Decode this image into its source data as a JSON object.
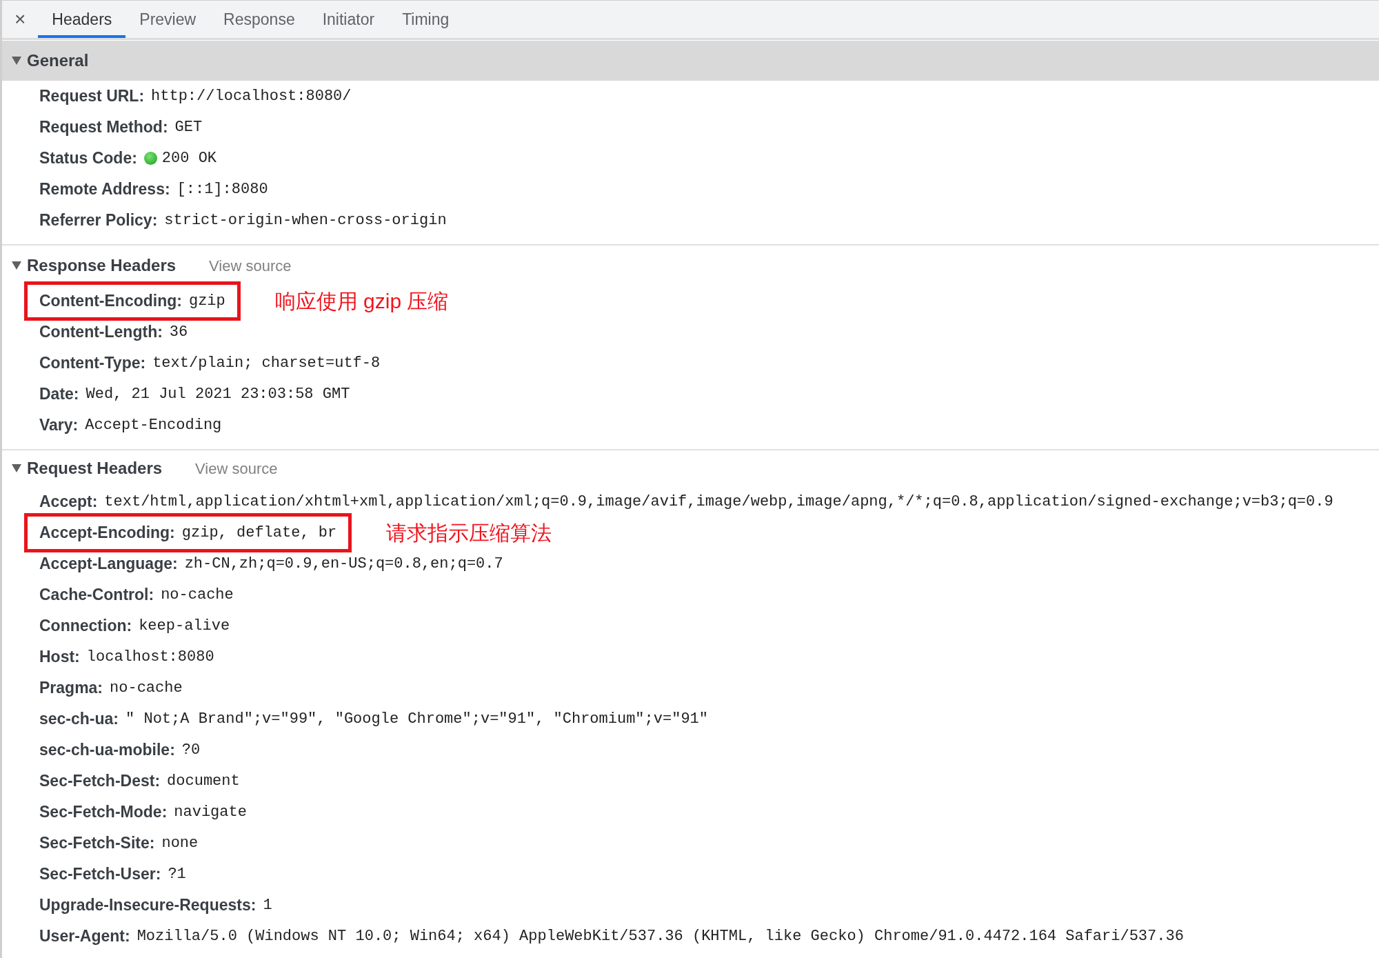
{
  "close_button": "×",
  "tabs": [
    {
      "label": "Headers",
      "selected": true
    },
    {
      "label": "Preview",
      "selected": false
    },
    {
      "label": "Response",
      "selected": false
    },
    {
      "label": "Initiator",
      "selected": false
    },
    {
      "label": "Timing",
      "selected": false
    }
  ],
  "sections": [
    {
      "title": "General",
      "expanded": true,
      "selected": true,
      "rows": [
        {
          "kind": "plain",
          "name": "Request URL:",
          "value": "http://localhost:8080/",
          "highlighted": false
        },
        {
          "kind": "plain",
          "name": "Request Method:",
          "value": "GET",
          "highlighted": false
        },
        {
          "kind": "status",
          "name": "Status Code:",
          "value": "200 OK",
          "highlighted": false
        },
        {
          "kind": "plain",
          "name": "Remote Address:",
          "value": "[::1]:8080",
          "highlighted": false
        },
        {
          "kind": "plain",
          "name": "Referrer Policy:",
          "value": "strict-origin-when-cross-origin",
          "highlighted": false
        }
      ]
    },
    {
      "title": "Response Headers",
      "link": "View source",
      "expanded": true,
      "selected": false,
      "rows": [
        {
          "kind": "plain",
          "name": "Content-Encoding:",
          "value": "gzip",
          "highlighted": true,
          "annotation": "响应使用 gzip 压缩"
        },
        {
          "kind": "plain",
          "name": "Content-Length:",
          "value": "36",
          "highlighted": false
        },
        {
          "kind": "plain",
          "name": "Content-Type:",
          "value": "text/plain; charset=utf-8",
          "highlighted": false
        },
        {
          "kind": "plain",
          "name": "Date:",
          "value": "Wed, 21 Jul 2021 23:03:58 GMT",
          "highlighted": false
        },
        {
          "kind": "plain",
          "name": "Vary:",
          "value": "Accept-Encoding",
          "highlighted": false
        }
      ]
    },
    {
      "title": "Request Headers",
      "link": "View source",
      "expanded": true,
      "selected": false,
      "rows": [
        {
          "kind": "plain",
          "name": "Accept:",
          "value": "text/html,application/xhtml+xml,application/xml;q=0.9,image/avif,image/webp,image/apng,*/*;q=0.8,application/signed-exchange;v=b3;q=0.9",
          "highlighted": false
        },
        {
          "kind": "plain",
          "name": "Accept-Encoding:",
          "value": "gzip, deflate, br",
          "highlighted": true,
          "annotation": "请求指示压缩算法"
        },
        {
          "kind": "plain",
          "name": "Accept-Language:",
          "value": "zh-CN,zh;q=0.9,en-US;q=0.8,en;q=0.7",
          "highlighted": false
        },
        {
          "kind": "plain",
          "name": "Cache-Control:",
          "value": "no-cache",
          "highlighted": false
        },
        {
          "kind": "plain",
          "name": "Connection:",
          "value": "keep-alive",
          "highlighted": false
        },
        {
          "kind": "plain",
          "name": "Host:",
          "value": "localhost:8080",
          "highlighted": false
        },
        {
          "kind": "plain",
          "name": "Pragma:",
          "value": "no-cache",
          "highlighted": false
        },
        {
          "kind": "plain",
          "name": "sec-ch-ua:",
          "value": "\" Not;A Brand\";v=\"99\", \"Google Chrome\";v=\"91\", \"Chromium\";v=\"91\"",
          "highlighted": false
        },
        {
          "kind": "plain",
          "name": "sec-ch-ua-mobile:",
          "value": "?0",
          "highlighted": false
        },
        {
          "kind": "plain",
          "name": "Sec-Fetch-Dest:",
          "value": "document",
          "highlighted": false
        },
        {
          "kind": "plain",
          "name": "Sec-Fetch-Mode:",
          "value": "navigate",
          "highlighted": false
        },
        {
          "kind": "plain",
          "name": "Sec-Fetch-Site:",
          "value": "none",
          "highlighted": false
        },
        {
          "kind": "plain",
          "name": "Sec-Fetch-User:",
          "value": "?1",
          "highlighted": false
        },
        {
          "kind": "plain",
          "name": "Upgrade-Insecure-Requests:",
          "value": "1",
          "highlighted": false
        },
        {
          "kind": "plain",
          "name": "User-Agent:",
          "value": "Mozilla/5.0 (Windows NT 10.0; Win64; x64) AppleWebKit/537.36 (KHTML, like Gecko) Chrome/91.0.4472.164 Safari/537.36",
          "highlighted": false
        }
      ]
    }
  ]
}
